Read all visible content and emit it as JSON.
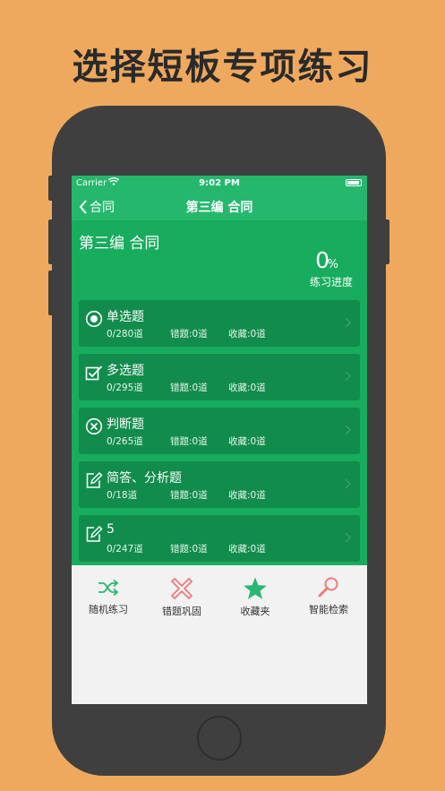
{
  "headline": "选择短板专项练习",
  "status_bar": {
    "carrier": "Carrier",
    "time": "9:02 PM"
  },
  "nav": {
    "back_label": "合同",
    "title": "第三编 合同"
  },
  "section": {
    "title": "第三编 合同",
    "progress_value": "0",
    "progress_unit": "%",
    "progress_label": "练习进度"
  },
  "categories": [
    {
      "name": "单选题",
      "total": "0/280道",
      "wrong": "错题:0道",
      "fav": "收藏:0道",
      "icon": "radio-icon"
    },
    {
      "name": "多选题",
      "total": "0/295道",
      "wrong": "错题:0道",
      "fav": "收藏:0道",
      "icon": "checkbox-icon"
    },
    {
      "name": "判断题",
      "total": "0/265道",
      "wrong": "错题:0道",
      "fav": "收藏:0道",
      "icon": "x-circle-icon"
    },
    {
      "name": "简答、分析题",
      "total": "0/18道",
      "wrong": "错题:0道",
      "fav": "收藏:0道",
      "icon": "edit-icon"
    },
    {
      "name": "5",
      "total": "0/247道",
      "wrong": "错题:0道",
      "fav": "收藏:0道",
      "icon": "edit-icon"
    }
  ],
  "tabs": [
    {
      "label": "随机练习",
      "icon": "shuffle-icon",
      "color": "#2BB673"
    },
    {
      "label": "错题巩固",
      "icon": "cross-icon",
      "color": "#F07A7A"
    },
    {
      "label": "收藏夹",
      "icon": "star-icon",
      "color": "#2BB673"
    },
    {
      "label": "智能检索",
      "icon": "search-icon",
      "color": "#F07A7A"
    }
  ],
  "colors": {
    "background": "#EFA95E",
    "primary_green": "#18AC5E",
    "card_green": "#118C4C"
  }
}
